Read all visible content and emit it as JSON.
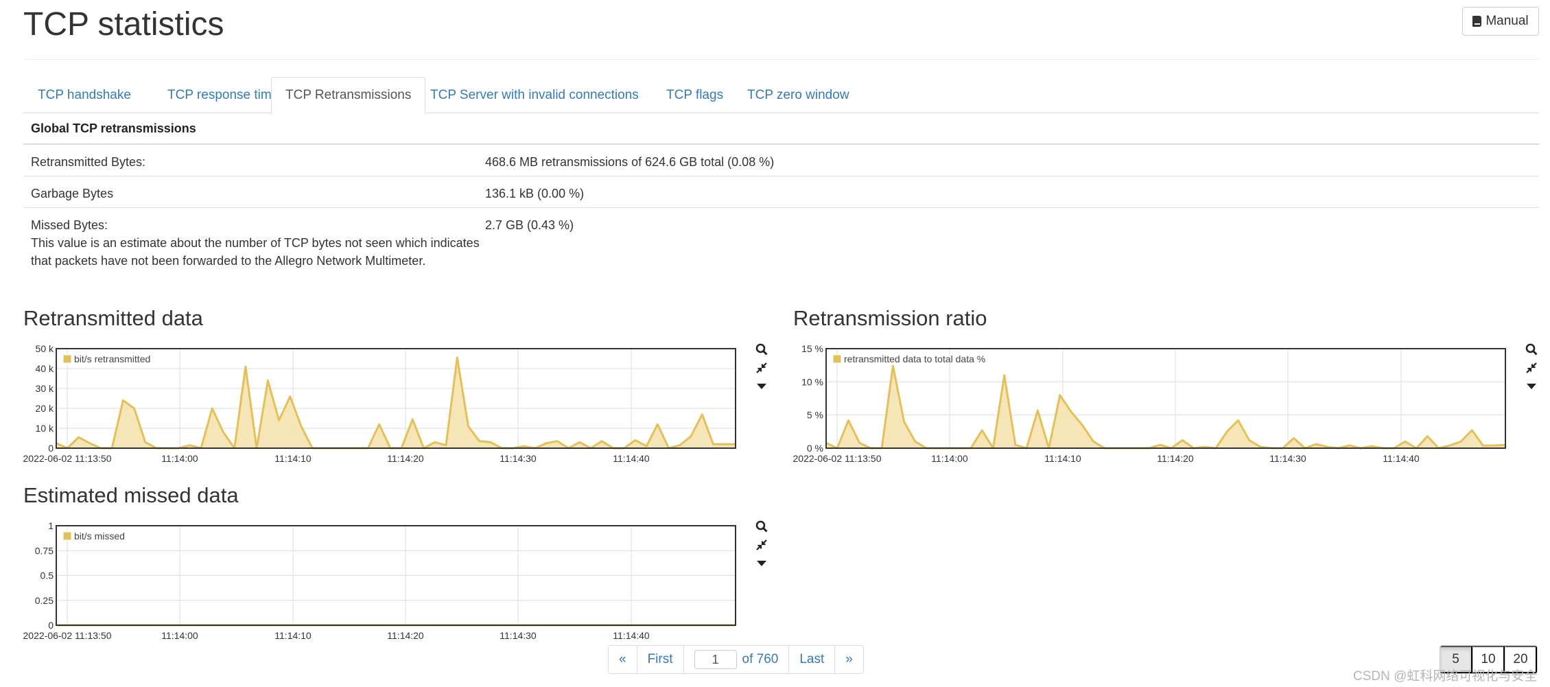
{
  "header": {
    "title": "TCP statistics",
    "manual_label": "Manual"
  },
  "tabs": [
    {
      "label": "TCP handshake",
      "active": false
    },
    {
      "label": "TCP response time",
      "active": false
    },
    {
      "label": "TCP Retransmissions",
      "active": true
    },
    {
      "label": "TCP Server with invalid connections",
      "active": false
    },
    {
      "label": "TCP flags",
      "active": false
    },
    {
      "label": "TCP zero window",
      "active": false
    }
  ],
  "stats": {
    "heading": "Global TCP retransmissions",
    "rows": [
      {
        "label": "Retransmitted Bytes:",
        "value": "468.6 MB retransmissions of 624.6 GB total (0.08 %)"
      },
      {
        "label": "Garbage Bytes",
        "value": "136.1 kB (0.00 %)"
      },
      {
        "label": "Missed Bytes:",
        "note": "This value is an estimate about the number of TCP bytes not seen which indicates that packets have not been forwarded to the Allegro Network Multimeter.",
        "value": "2.7 GB (0.43 %)"
      }
    ]
  },
  "charts": {
    "retransmitted": {
      "title": "Retransmitted data"
    },
    "ratio": {
      "title": "Retransmission ratio"
    },
    "missed": {
      "title": "Estimated missed data"
    }
  },
  "chart_data": [
    {
      "type": "area",
      "title": "Retransmitted data",
      "x_tick_labels": [
        "2022-06-02 11:13:50",
        "11:14:00",
        "11:14:10",
        "11:14:20",
        "11:14:30",
        "11:14:40"
      ],
      "y_tick_labels": [
        "0",
        "10 k",
        "20 k",
        "30 k",
        "40 k",
        "50 k"
      ],
      "ylim": [
        0,
        50000
      ],
      "grid": true,
      "legend_position": "top-left",
      "color": "#e4c05a",
      "series": [
        {
          "name": "bit/s retransmitted",
          "values": [
            2500,
            0,
            5500,
            2500,
            0,
            0,
            24000,
            20000,
            3000,
            0,
            0,
            0,
            1500,
            0,
            20000,
            8000,
            0,
            41000,
            0,
            34000,
            14000,
            26000,
            11000,
            0,
            0,
            0,
            0,
            0,
            0,
            12000,
            0,
            0,
            14500,
            0,
            3000,
            1500,
            45500,
            11000,
            3500,
            3000,
            0,
            0,
            1000,
            0,
            2500,
            3500,
            0,
            3000,
            0,
            3500,
            0,
            0,
            4000,
            1000,
            12000,
            0,
            1500,
            6000,
            17000,
            2000,
            2000,
            2000
          ]
        }
      ]
    },
    {
      "type": "area",
      "title": "Retransmission ratio",
      "x_tick_labels": [
        "2022-06-02 11:13:50",
        "11:14:00",
        "11:14:10",
        "11:14:20",
        "11:14:30",
        "11:14:40"
      ],
      "y_tick_labels": [
        "0 %",
        "5 %",
        "10 %",
        "15 %"
      ],
      "ylim": [
        0,
        15
      ],
      "grid": true,
      "legend_position": "top-left",
      "color": "#e4c05a",
      "series": [
        {
          "name": "retransmitted data to total data %",
          "values": [
            0.8,
            0,
            4.2,
            0.8,
            0,
            0,
            12.4,
            4,
            1,
            0,
            0,
            0,
            0,
            0,
            2.7,
            0,
            11,
            0.5,
            0,
            5.7,
            0,
            8,
            5.5,
            3.5,
            1,
            0,
            0,
            0,
            0,
            0,
            0.5,
            0,
            1.2,
            0,
            0.2,
            0,
            2.5,
            4.2,
            1.2,
            0.2,
            0,
            0,
            1.5,
            0,
            0.6,
            0.2,
            0,
            0.4,
            0,
            0.3,
            0,
            0,
            1,
            0,
            1.8,
            0,
            0.4,
            1,
            2.7,
            0.4,
            0.4,
            0.5
          ]
        }
      ]
    },
    {
      "type": "area",
      "title": "Estimated missed data",
      "x_tick_labels": [
        "2022-06-02 11:13:50",
        "11:14:00",
        "11:14:10",
        "11:14:20",
        "11:14:30",
        "11:14:40"
      ],
      "y_tick_labels": [
        "0",
        "0.25",
        "0.5",
        "0.75",
        "1"
      ],
      "ylim": [
        0,
        1
      ],
      "grid": true,
      "legend_position": "top-left",
      "color": "#e4c05a",
      "series": [
        {
          "name": "bit/s missed",
          "values": [
            0,
            0,
            0,
            0,
            0,
            0,
            0,
            0,
            0,
            0,
            0,
            0,
            0,
            0,
            0,
            0,
            0,
            0,
            0,
            0,
            0,
            0,
            0,
            0,
            0,
            0,
            0,
            0,
            0,
            0,
            0,
            0,
            0,
            0,
            0,
            0,
            0,
            0,
            0,
            0,
            0,
            0,
            0,
            0,
            0,
            0,
            0,
            0,
            0,
            0,
            0,
            0,
            0,
            0,
            0,
            0,
            0,
            0,
            0,
            0,
            0,
            0
          ]
        }
      ]
    }
  ],
  "pagination": {
    "prev_label": "«",
    "first_label": "First",
    "page_value": "1",
    "of_label": "of 760",
    "last_label": "Last",
    "next_label": "»"
  },
  "page_size": {
    "options": [
      "5",
      "10",
      "20"
    ],
    "selected": "5"
  },
  "watermark": "CSDN @虹科网络可视化与安全",
  "colors": {
    "link": "#337ab7",
    "series": "#e4c05a",
    "series_fill": "#f5e2aa"
  }
}
